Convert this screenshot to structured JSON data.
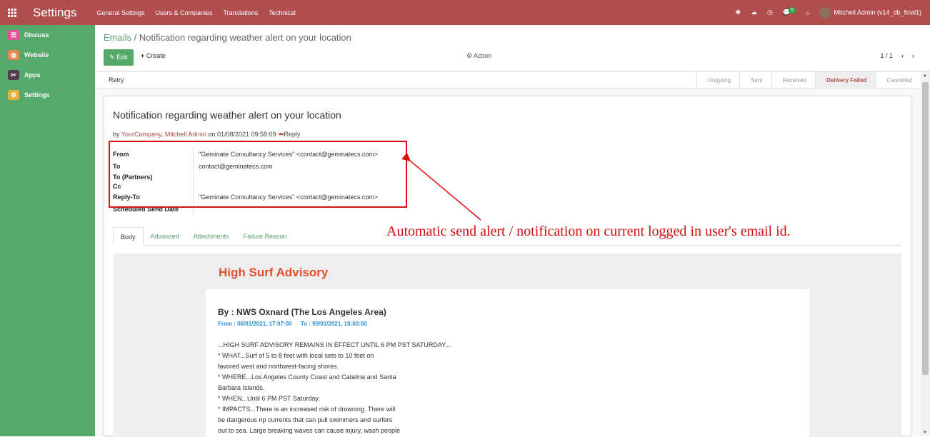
{
  "navbar": {
    "brand": "Settings",
    "menu": [
      "General Settings",
      "Users & Companies",
      "Translations",
      "Technical"
    ],
    "badge_count": "5",
    "user": "Mitchell Admin (v14_db_final1)"
  },
  "sidebar": {
    "items": [
      {
        "label": "Discuss",
        "color": "#e4519b",
        "glyph": "☰"
      },
      {
        "label": "Website",
        "color": "#e6894c",
        "glyph": "◍"
      },
      {
        "label": "Apps",
        "color": "#553a4e",
        "glyph": "✂"
      },
      {
        "label": "Settings",
        "color": "#e3b03e",
        "glyph": "⚙"
      }
    ]
  },
  "breadcrumb": {
    "parent": "Emails",
    "sep": "/",
    "current": "Notification regarding weather alert on your location"
  },
  "buttons": {
    "edit": "Edit",
    "create": "Create",
    "action": "Action"
  },
  "pager": {
    "value": "1 / 1"
  },
  "statusbar": {
    "retry": "Retry",
    "stages": [
      "Outgoing",
      "Sent",
      "Received",
      "Delivery Failed",
      "Cancelled"
    ],
    "active_stage": "Delivery Failed"
  },
  "message": {
    "subject": "Notification regarding weather alert on your location",
    "by": "by",
    "author": "YourCompany, Mitchell Admin",
    "on": "on 01/08/2021 09:58:09",
    "reply": "Reply"
  },
  "fields": {
    "from_label": "From",
    "from_value": "\"Geminate Consultancy Services\" <contact@geminatecs.com>",
    "to_label": "To",
    "to_value": "contact@geminatecs.com",
    "to_partners_label": "To (Partners)",
    "cc_label": "Cc",
    "reply_to_label": "Reply-To",
    "reply_to_value": "\"Geminate Consultancy Services\" <contact@geminatecs.com>",
    "scheduled_label": "Scheduled Send Date"
  },
  "annotation": "Automatic send alert / notification on current logged in user's email id.",
  "tabs": [
    "Body",
    "Advanced",
    "Attachments",
    "Failure Reason"
  ],
  "body": {
    "title": "High Surf Advisory",
    "by": "By : NWS Oxnard (The Los Angeles Area)",
    "from": "From : 06/01/2021, 17:07:00",
    "to": "To : 09/01/2021, 18:00:00",
    "lines": [
      "...HIGH SURF ADVISORY REMAINS IN EFFECT UNTIL 6 PM PST SATURDAY...",
      "* WHAT...Surf of 5 to 8 feet with local sets to 10 feet on",
      "favored west and northwest-facing shores.",
      "* WHERE...Los Angeles County Coast and Catalina and Santa",
      "Barbara Islands.",
      "* WHEN...Until 6 PM PST Saturday.",
      "* IMPACTS...There is an increased risk of drowning. There will",
      "be dangerous rip currents that can pull swimmers and surfers",
      "out to sea. Large breaking waves can cause injury, wash people"
    ]
  }
}
